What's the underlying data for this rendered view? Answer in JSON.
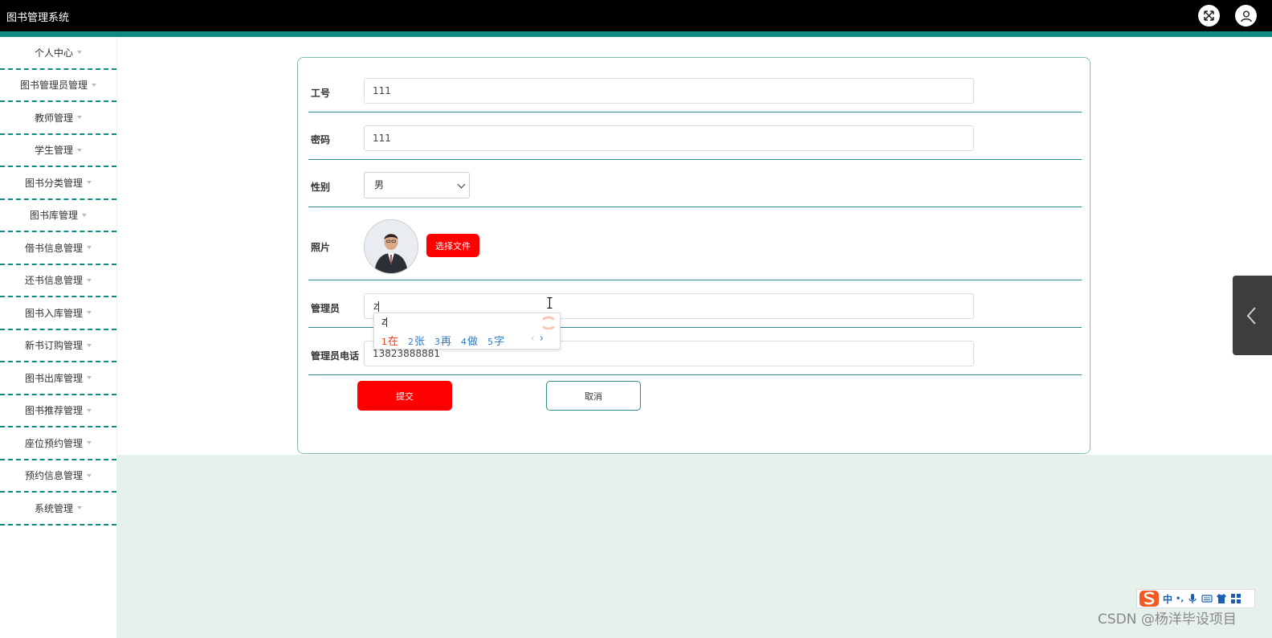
{
  "app": {
    "title": "图书管理系统"
  },
  "sidebar": {
    "items": [
      {
        "label": "个人中心"
      },
      {
        "label": "图书管理员管理"
      },
      {
        "label": "教师管理"
      },
      {
        "label": "学生管理"
      },
      {
        "label": "图书分类管理"
      },
      {
        "label": "图书库管理"
      },
      {
        "label": "借书信息管理"
      },
      {
        "label": "还书信息管理"
      },
      {
        "label": "图书入库管理"
      },
      {
        "label": "新书订购管理"
      },
      {
        "label": "图书出库管理"
      },
      {
        "label": "图书推荐管理"
      },
      {
        "label": "座位预约管理"
      },
      {
        "label": "预约信息管理"
      },
      {
        "label": "系统管理"
      }
    ]
  },
  "form": {
    "employee_id": {
      "label": "工号",
      "value": "111"
    },
    "password": {
      "label": "密码",
      "value": "111"
    },
    "gender": {
      "label": "性别",
      "value": "男"
    },
    "photo": {
      "label": "照片",
      "button": "选择文件"
    },
    "manager": {
      "label": "管理员",
      "value": "z"
    },
    "phone": {
      "label": "管理员电话",
      "value": "13823888881"
    },
    "submit_label": "提交",
    "cancel_label": "取消"
  },
  "ime": {
    "composition": "z",
    "candidates": [
      {
        "num": "1",
        "text": "在"
      },
      {
        "num": "2",
        "text": "张"
      },
      {
        "num": "3",
        "text": "再"
      },
      {
        "num": "4",
        "text": "做"
      },
      {
        "num": "5",
        "text": "字"
      }
    ],
    "toolbar_mode": "中",
    "toolbar_punct": "•,"
  },
  "watermark": "CSDN @杨洋毕设项目",
  "colors": {
    "accent": "#0f8a80",
    "primary_button": "#ff0000",
    "topbar": "#000000"
  }
}
